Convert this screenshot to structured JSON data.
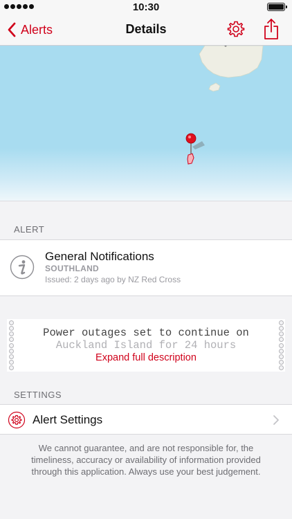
{
  "status_bar": {
    "time": "10:30"
  },
  "nav": {
    "back_label": "Alerts",
    "title": "Details"
  },
  "colors": {
    "accent": "#d0021b",
    "water": "#a8dcf0",
    "land": "#eeeee4"
  },
  "icons": {
    "back": "chevron-left-icon",
    "settings": "gear-icon",
    "share": "share-icon",
    "alert_type": "info-icon",
    "alert_settings": "gear-icon",
    "disclosure": "chevron-right-icon"
  },
  "alert_section": {
    "header": "ALERT",
    "title": "General Notifications",
    "region": "SOUTHLAND",
    "issued": "Issued: 2 days ago by NZ Red Cross"
  },
  "description": {
    "line1": "Power outages set to continue on",
    "line2": "Auckland Island for 24 hours",
    "expand_label": "Expand full description"
  },
  "settings_section": {
    "header": "SETTINGS",
    "item_label": "Alert Settings"
  },
  "disclaimer": "We cannot guarantee, and are not responsible for, the timeliness, accuracy or availability of information provided through this application. Always use your best judgement."
}
